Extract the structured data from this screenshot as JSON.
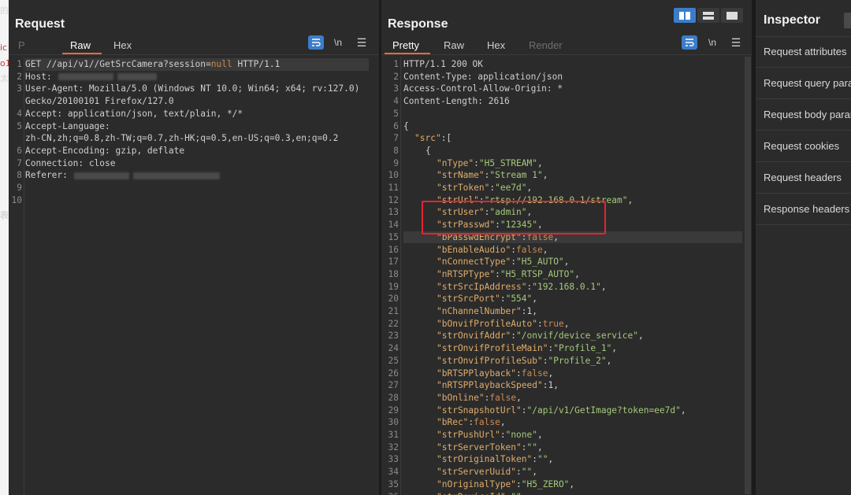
{
  "left_strip": [
    "的",
    "ic",
    "o1",
    "太",
    "表"
  ],
  "request": {
    "title": "Request",
    "tabs": [
      "P",
      "Raw",
      "Hex"
    ],
    "active_tab": "Raw",
    "tool_newline": "\\n",
    "lines": [
      {
        "n": "1",
        "t": "GET //api/v1//GetSrcCamera?session=null HTTP/1.1"
      },
      {
        "n": "2",
        "t": "Host:"
      },
      {
        "n": "3",
        "t": "User-Agent: Mozilla/5.0 (Windows NT 10.0; Win64; x64; rv:127.0)"
      },
      {
        "n": "",
        "t": "Gecko/20100101 Firefox/127.0"
      },
      {
        "n": "4",
        "t": "Accept: application/json, text/plain, */*"
      },
      {
        "n": "5",
        "t": "Accept-Language:"
      },
      {
        "n": "",
        "t": "zh-CN,zh;q=0.8,zh-TW;q=0.7,zh-HK;q=0.5,en-US;q=0.3,en;q=0.2"
      },
      {
        "n": "6",
        "t": "Accept-Encoding: gzip, deflate"
      },
      {
        "n": "7",
        "t": "Connection: close"
      },
      {
        "n": "8",
        "t": "Referer:"
      },
      {
        "n": "9",
        "t": ""
      },
      {
        "n": "10",
        "t": ""
      }
    ]
  },
  "response": {
    "title": "Response",
    "tabs": [
      "Pretty",
      "Raw",
      "Hex",
      "Render"
    ],
    "active_tab": "Pretty",
    "tool_newline": "\\n",
    "headers": [
      "HTTP/1.1 200 OK",
      "Content-Type: application/json",
      "Access-Control-Allow-Origin: *",
      "Content-Length: 2616"
    ],
    "body_open": [
      "{",
      "\"src\":[",
      "{"
    ],
    "fields": [
      {
        "k": "\"nType\"",
        "v": "\"H5_STREAM\"",
        "type": "str"
      },
      {
        "k": "\"strName\"",
        "v": "\"Stream 1\"",
        "type": "str"
      },
      {
        "k": "\"strToken\"",
        "v": "\"ee7d\"",
        "type": "str"
      },
      {
        "k": "\"strUrl\"",
        "v": "\"rtsp://192.168.0.1/stream\"",
        "type": "str"
      },
      {
        "k": "\"strUser\"",
        "v": "\"admin\"",
        "type": "str"
      },
      {
        "k": "\"strPasswd\"",
        "v": "\"12345\"",
        "type": "str"
      },
      {
        "k": "\"bPasswdEncrypt\"",
        "v": "false",
        "type": "kw"
      },
      {
        "k": "\"bEnableAudio\"",
        "v": "false",
        "type": "kw"
      },
      {
        "k": "\"nConnectType\"",
        "v": "\"H5_AUTO\"",
        "type": "str"
      },
      {
        "k": "\"nRTSPType\"",
        "v": "\"H5_RTSP_AUTO\"",
        "type": "str"
      },
      {
        "k": "\"strSrcIpAddress\"",
        "v": "\"192.168.0.1\"",
        "type": "str"
      },
      {
        "k": "\"strSrcPort\"",
        "v": "\"554\"",
        "type": "str"
      },
      {
        "k": "\"nChannelNumber\"",
        "v": "1",
        "type": "num"
      },
      {
        "k": "\"bOnvifProfileAuto\"",
        "v": "true",
        "type": "kw"
      },
      {
        "k": "\"strOnvifAddr\"",
        "v": "\"/onvif/device_service\"",
        "type": "str"
      },
      {
        "k": "\"strOnvifProfileMain\"",
        "v": "\"Profile_1\"",
        "type": "str"
      },
      {
        "k": "\"strOnvifProfileSub\"",
        "v": "\"Profile_2\"",
        "type": "str"
      },
      {
        "k": "\"bRTSPPlayback\"",
        "v": "false",
        "type": "kw"
      },
      {
        "k": "\"nRTSPPlaybackSpeed\"",
        "v": "1",
        "type": "num"
      },
      {
        "k": "\"bOnline\"",
        "v": "false",
        "type": "kw"
      },
      {
        "k": "\"strSnapshotUrl\"",
        "v": "\"/api/v1/GetImage?token=ee7d\"",
        "type": "str"
      },
      {
        "k": "\"bRec\"",
        "v": "false",
        "type": "kw"
      },
      {
        "k": "\"strPushUrl\"",
        "v": "\"none\"",
        "type": "str"
      },
      {
        "k": "\"strServerToken\"",
        "v": "\"\"",
        "type": "str"
      },
      {
        "k": "\"strOriginalToken\"",
        "v": "\"\"",
        "type": "str"
      },
      {
        "k": "\"strServerUuid\"",
        "v": "\"\"",
        "type": "str"
      },
      {
        "k": "\"nOriginalType\"",
        "v": "\"H5_ZERO\"",
        "type": "str"
      },
      {
        "k": "\"strDeviceId\"",
        "v": "\"\"",
        "type": "str"
      }
    ]
  },
  "inspector": {
    "title": "Inspector",
    "items": [
      "Request attributes",
      "Request query parameters",
      "Request body parameters",
      "Request cookies",
      "Request headers",
      "Response headers"
    ]
  },
  "colors": {
    "accent": "#e8693a",
    "highlight_box": "#e5252c",
    "active_button": "#3d7cc9",
    "json_key": "#e0ad6b",
    "json_string": "#a5c97b"
  }
}
